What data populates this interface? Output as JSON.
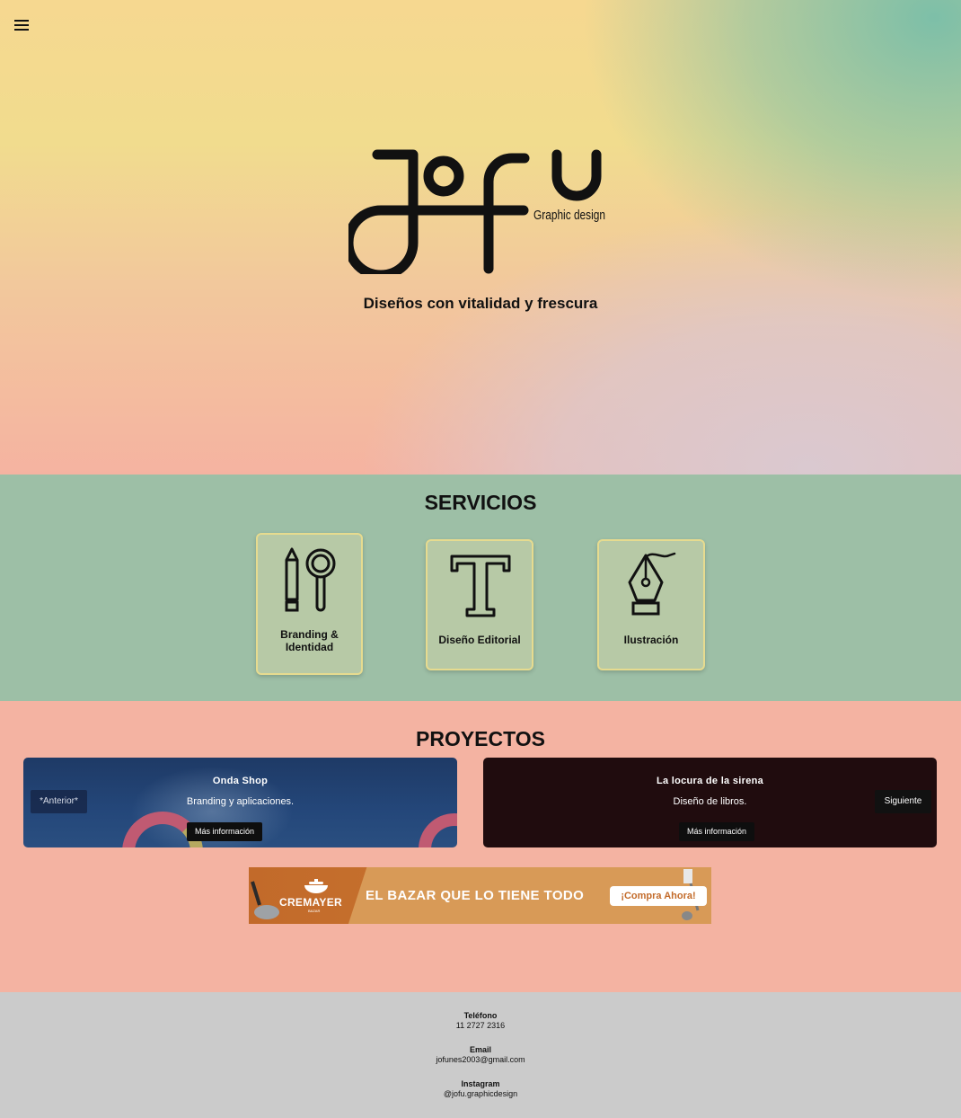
{
  "hero": {
    "menu_icon": "hamburger-icon",
    "logo_text": "jofu",
    "logo_subtext": "Graphic design",
    "tagline": "Diseños con vitalidad y frescura"
  },
  "servicios": {
    "title": "SERVICIOS",
    "cards": [
      {
        "label_line1": "Branding &",
        "label_line2": "Identidad",
        "icon": "pencil-magnifier-icon"
      },
      {
        "label": "Diseño Editorial",
        "icon": "letter-t-icon"
      },
      {
        "label": "Ilustración",
        "icon": "pen-nib-icon"
      }
    ]
  },
  "proyectos": {
    "title": "PROYECTOS",
    "items": [
      {
        "title": "Onda Shop",
        "subtitle": "Branding y aplicaciones.",
        "button": "Más información"
      },
      {
        "title": "La locura de la sirena",
        "subtitle": "Diseño de libros.",
        "button": "Más información"
      }
    ],
    "prev_label": "*Anterior*",
    "next_label": "Siguiente"
  },
  "banner": {
    "brand": "CREMAYER",
    "brand_sub": "BAZAR",
    "headline": "EL BAZAR QUE LO TIENE TODO",
    "cta": "¡Compra Ahora!"
  },
  "footer": {
    "phone_label": "Teléfono",
    "phone": "11 2727 2316",
    "email_label": "Email",
    "email": "jofunes2003@gmail.com",
    "instagram_label": "Instagram",
    "instagram": "@jofu.graphicdesign"
  },
  "colors": {
    "servicios_bg": "#9dbfa6",
    "proyectos_bg": "#f4b3a2",
    "footer_bg": "#cbcbcb",
    "card_bg": "#b7c9a6",
    "card_border": "#e6db8f",
    "banner_orange": "#c26a2a"
  }
}
